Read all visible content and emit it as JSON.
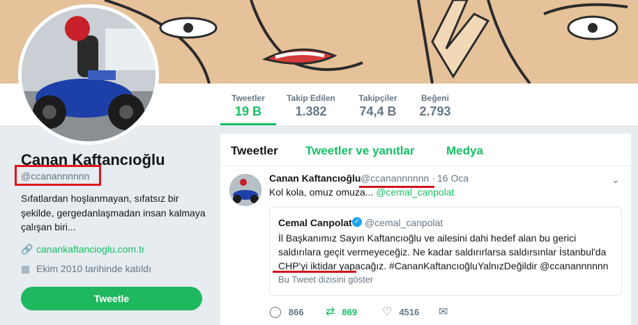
{
  "profile": {
    "name": "Canan Kaftancıoğlu",
    "handle": "@ccanannnnnn",
    "bio": "Sıfatlardan hoşlanmayan, sıfatsız bir şekilde, gergedanlaşmadan insan kalmaya çalışan biri...",
    "website": "canankaftancioglu.com.tr",
    "joined": "Ekim 2010 tarihinde katıldı",
    "tweet_button": "Tweetle",
    "link_icon": "link-icon",
    "calendar_icon": "calendar-icon"
  },
  "stats": [
    {
      "label": "Tweetler",
      "value": "19 B",
      "active": true
    },
    {
      "label": "Takip Edilen",
      "value": "1.382",
      "active": false
    },
    {
      "label": "Takipçiler",
      "value": "74,4 B",
      "active": false
    },
    {
      "label": "Beğeni",
      "value": "2.793",
      "active": false
    }
  ],
  "tabs": [
    "Tweetler",
    "Tweetler ve yanıtlar",
    "Medya"
  ],
  "tweet": {
    "author_name": "Canan Kaftancıoğlu",
    "author_handle": "@ccanannnnnn",
    "separator": "·",
    "date": "16 Oca",
    "text_prefix": "Kol kola, omuz omuza... ",
    "text_mention": "@cemal_canpolat",
    "quote": {
      "author_name": "Cemal Canpolat",
      "author_handle": "@cemal_canpolat",
      "text": "İl Başkanımız Sayın Kaftancıoğlu ve ailesini dahi hedef alan bu gerici saldırılara geçit vermeyeceğiz. Ne kadar saldırırlarsa saldırsınlar İstanbul'da CHP'yi iktidar yapacağız. #CananKaftancıoğluYalnızDeğildir @ccanannnnnn",
      "thread_link": "Bu Tweet dizisini göster"
    },
    "actions": {
      "reply_count": "866",
      "retweet_count": "869",
      "like_count": "4516"
    }
  },
  "colors": {
    "accent": "#17bf63",
    "annotation_red": "#e0151b"
  }
}
